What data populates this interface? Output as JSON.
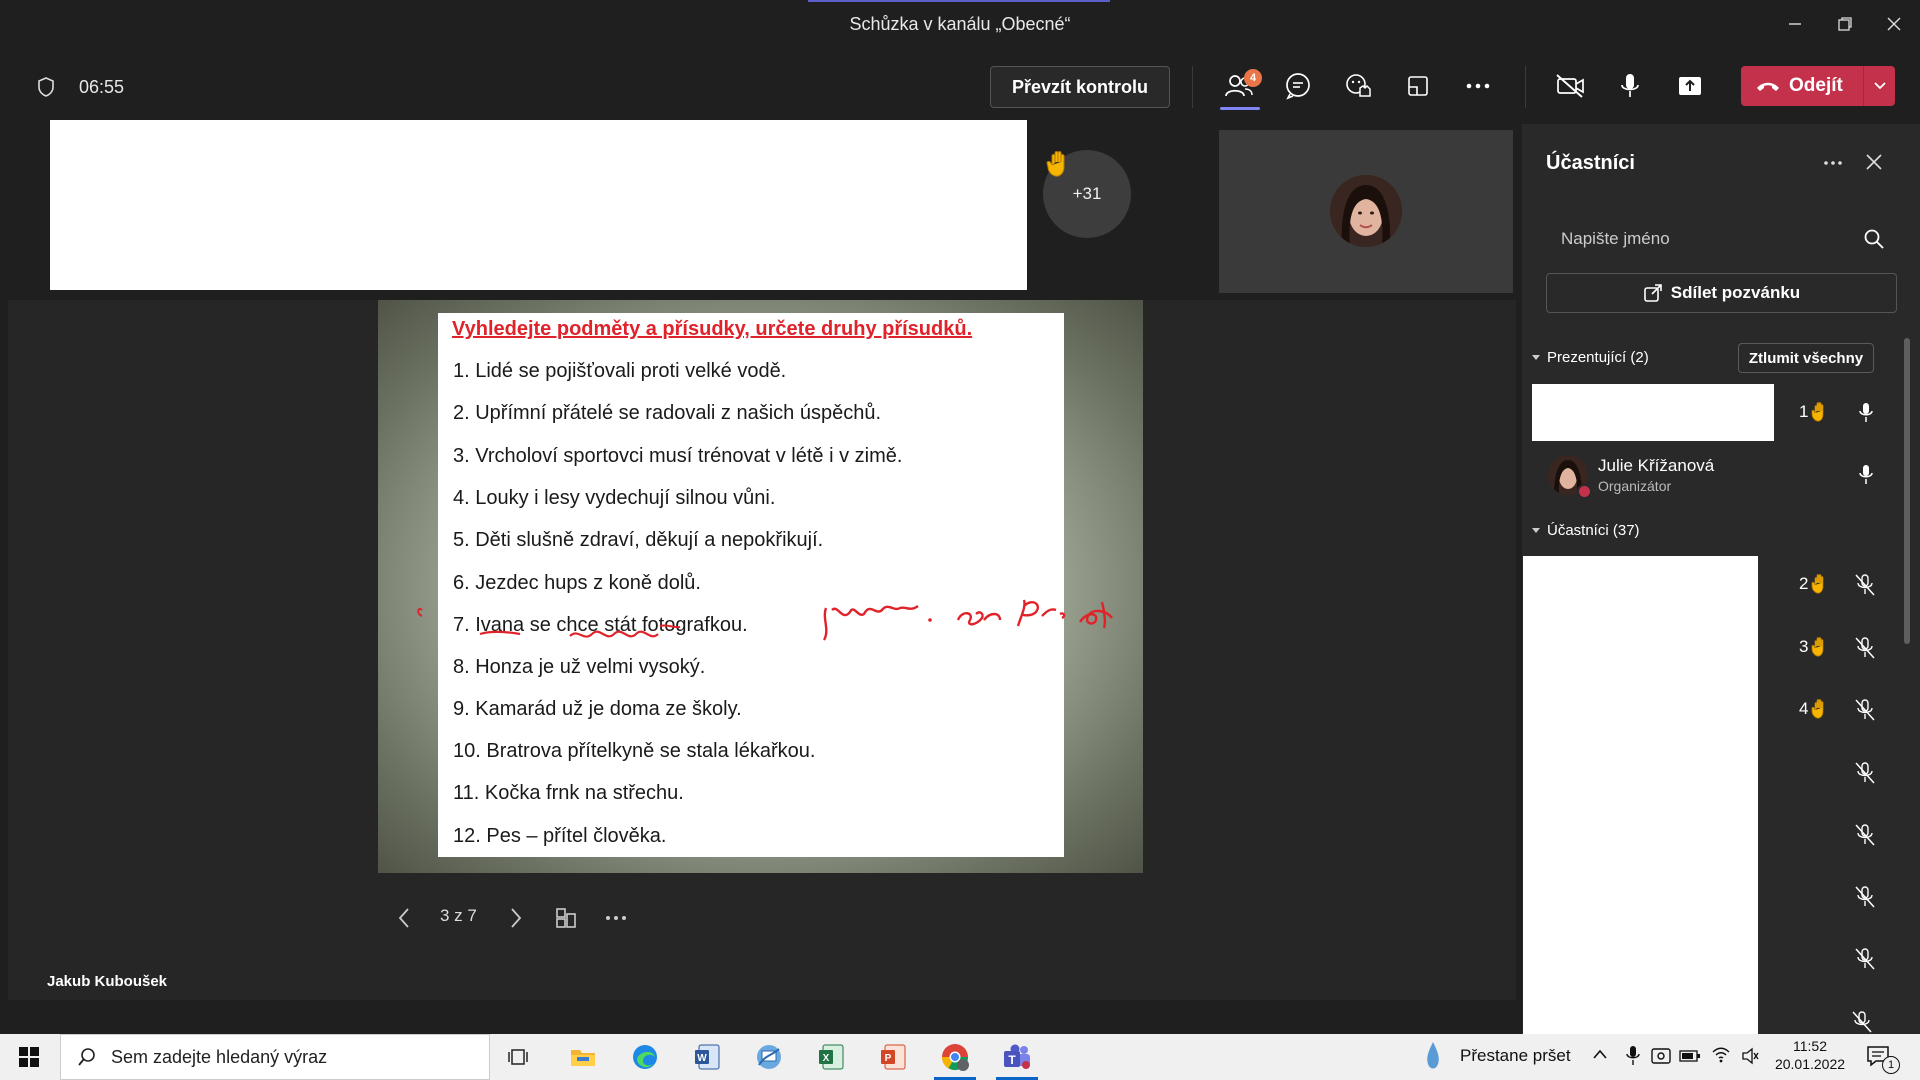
{
  "window": {
    "title": "Schůzka v kanálu „Obecné“"
  },
  "toolbar": {
    "timer": "06:55",
    "take_control": "Převzít kontrolu",
    "participants_badge": "4",
    "leave_label": "Odejít"
  },
  "stage": {
    "raised_hands_overflow": "+31",
    "presenter_name": "Jakub Kuboušek",
    "slide": {
      "heading": "Vyhledejte podměty a přísudky, určete druhy přísudků.",
      "items": [
        "1. Lidé se pojišťovali proti velké vodě.",
        "2. Upřímní přátelé se radovali z našich úspěchů.",
        "3. Vrcholoví sportovci musí trénovat v létě i v zimě.",
        "4. Louky i lesy vydechují silnou vůni.",
        "5. Děti slušně zdraví, děkují a nepokřikují.",
        "6. Jezdec hups z koně dolů.",
        "7. Ivana se chce stát fotografkou.",
        "8. Honza je už velmi vysoký.",
        "9. Kamarád už je doma ze školy.",
        "10. Bratrova přítelkyně se stala lékařkou.",
        "11. Kočka frnk na střechu.",
        "12. Pes – přítel člověka."
      ],
      "ink_color": "#e0232b"
    },
    "page_indicator": "3 z 7"
  },
  "panel": {
    "title": "Účastníci",
    "search_placeholder": "Napište jméno",
    "share_invite": "Sdílet pozvánku",
    "presenters_label": "Prezentující (2)",
    "mute_all": "Ztlumit všechny",
    "presenters": [
      {
        "hand_order": "1"
      },
      {
        "name": "Julie Křížanová",
        "role": "Organizátor"
      }
    ],
    "attendees_label": "Účastníci (37)",
    "attendee_hands": [
      "2",
      "3",
      "4"
    ]
  },
  "taskbar": {
    "search_placeholder": "Sem zadejte hledaný výraz",
    "weather": "Přestane pršet",
    "time": "11:52",
    "date": "20.01.2022",
    "notifications": "1"
  },
  "colors": {
    "leave": "#c4314b",
    "accent": "#7f85f5",
    "badge": "#e97548",
    "hand": "#f7b500"
  }
}
